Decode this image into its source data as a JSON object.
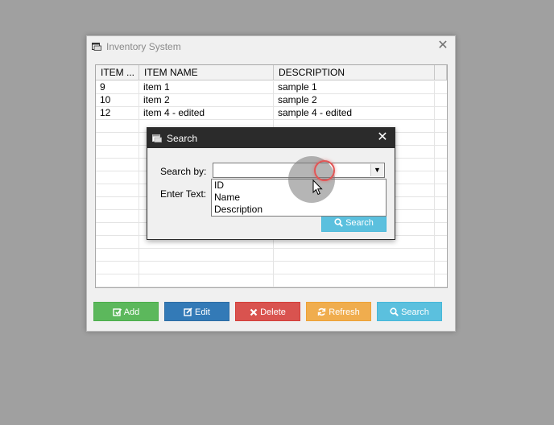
{
  "window": {
    "title": "Inventory System"
  },
  "grid": {
    "columns": [
      "ITEM ...",
      "ITEM NAME",
      "DESCRIPTION"
    ],
    "rows": [
      [
        "9",
        "item 1",
        "sample 1"
      ],
      [
        "10",
        "item 2",
        "sample 2"
      ],
      [
        "12",
        "item 4 - edited",
        "sample 4 - edited"
      ]
    ]
  },
  "buttons": {
    "add": "Add",
    "edit": "Edit",
    "delete": "Delete",
    "refresh": "Refresh",
    "search": "Search"
  },
  "colors": {
    "add": "#5cb85c",
    "edit": "#337ab7",
    "delete": "#d9534f",
    "refresh": "#f0ad4e",
    "search": "#5bc0de",
    "dialog_title": "#2b2b2b"
  },
  "dialog": {
    "title": "Search",
    "search_by_label": "Search by:",
    "enter_text_label": "Enter Text:",
    "search_by_value": "",
    "options": [
      "ID",
      "Name",
      "Description"
    ],
    "search_button": "Search"
  }
}
